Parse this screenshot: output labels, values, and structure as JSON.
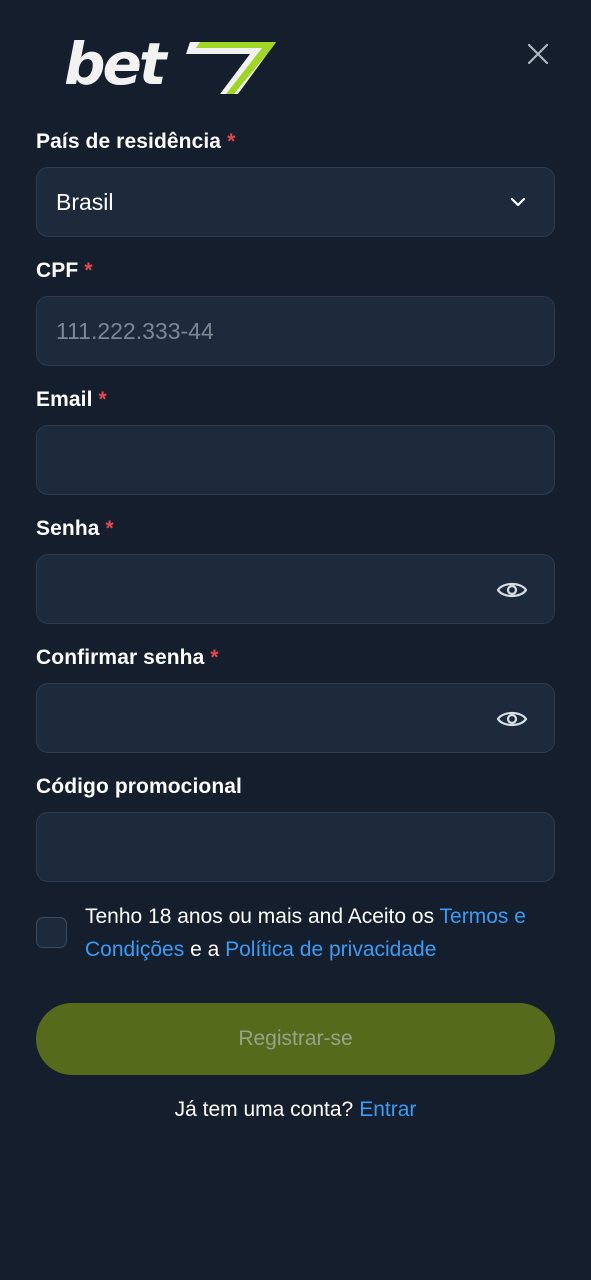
{
  "brand": {
    "logo_text": "bet7",
    "logo_accent_color": "#9fd625"
  },
  "header": {
    "close_icon": "close-icon"
  },
  "form": {
    "country": {
      "label": "País de residência",
      "required_mark": "*",
      "value": "Brasil",
      "icon": "chevron-down-icon"
    },
    "cpf": {
      "label": "CPF",
      "required_mark": "*",
      "value": "",
      "placeholder": "111.222.333-44"
    },
    "email": {
      "label": "Email",
      "required_mark": "*",
      "value": "",
      "placeholder": ""
    },
    "password": {
      "label": "Senha",
      "required_mark": "*",
      "value": "",
      "icon": "eye-icon"
    },
    "confirm_password": {
      "label": "Confirmar senha",
      "required_mark": "*",
      "value": "",
      "icon": "eye-icon"
    },
    "promo_code": {
      "label": "Código promocional",
      "value": ""
    }
  },
  "terms": {
    "checked": false,
    "text_1": "Tenho 18 anos ou mais and Aceito os ",
    "terms_link": "Termos e Condições",
    "text_2": " e a ",
    "privacy_link": "Política de privacidade"
  },
  "actions": {
    "register_label": "Registrar-se",
    "have_account_text": "Já tem uma conta?",
    "login_link": "Entrar"
  },
  "colors": {
    "background": "#141e2c",
    "field_background": "#1c2a3c",
    "required": "#e5484d",
    "link": "#3b9bf5",
    "button_disabled": "#556b1b"
  }
}
